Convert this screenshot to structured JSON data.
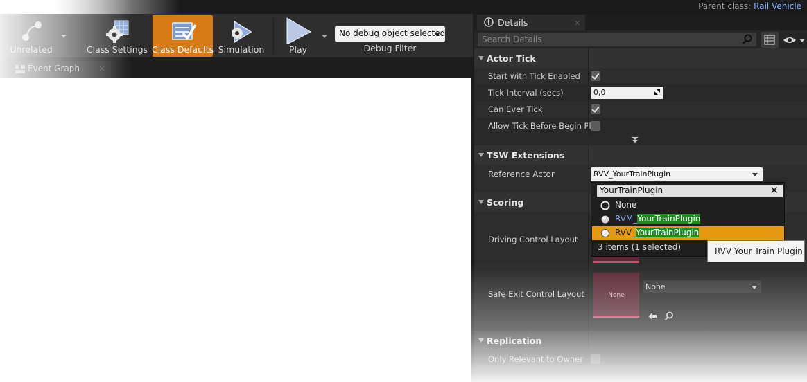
{
  "window": {
    "parent_class_label": "Parent class:",
    "parent_class_value": "Rail Vehicle"
  },
  "toolbar": {
    "unrelated_label": "Unrelated",
    "class_settings_label": "Class Settings",
    "class_defaults_label": "Class Defaults",
    "simulation_label": "Simulation",
    "play_label": "Play",
    "debug_object_value": "No debug object selected",
    "debug_filter_label": "Debug Filter",
    "accent_color": "#d87a15"
  },
  "graph": {
    "tab_label": "Event Graph"
  },
  "details": {
    "tab_label": "Details",
    "search_placeholder": "Search Details",
    "categories": {
      "actor_tick": {
        "title": "Actor Tick",
        "start_with_tick_enabled": {
          "label": "Start with Tick Enabled",
          "checked": true
        },
        "tick_interval": {
          "label": "Tick Interval (secs)",
          "value": "0,0"
        },
        "can_ever_tick": {
          "label": "Can Ever Tick",
          "checked": true
        },
        "allow_tick_before_begin_play": {
          "label": "Allow Tick Before Begin Play",
          "checked": false
        }
      },
      "tsw_extensions": {
        "title": "TSW Extensions",
        "reference_actor": {
          "label": "Reference Actor",
          "value": "RVV_YourTrainPlugin"
        }
      },
      "scoring": {
        "title": "Scoring",
        "driving_control_layout": {
          "label": "Driving Control Layout"
        },
        "safe_exit_control_layout": {
          "label": "Safe Exit Control Layout",
          "thumbnail_text": "None",
          "value": "None"
        }
      },
      "replication": {
        "title": "Replication",
        "only_relevant_to_owner": {
          "label": "Only Relevant to Owner",
          "checked": false
        }
      }
    }
  },
  "popup": {
    "filter_text": "YourTrainPlugin",
    "options": [
      {
        "prefix": "None",
        "match": "",
        "selected": false
      },
      {
        "prefix": "RVM_",
        "match": "YourTrainPlugin",
        "selected": false
      },
      {
        "prefix": "RVV_",
        "match": "YourTrainPlugin",
        "selected": true
      }
    ],
    "count_text": "3 items (1 selected)",
    "match_highlight_color": "#1f8a1f",
    "selected_color": "#e39a12"
  },
  "tooltip": {
    "text": "RVV Your Train Plugin"
  }
}
